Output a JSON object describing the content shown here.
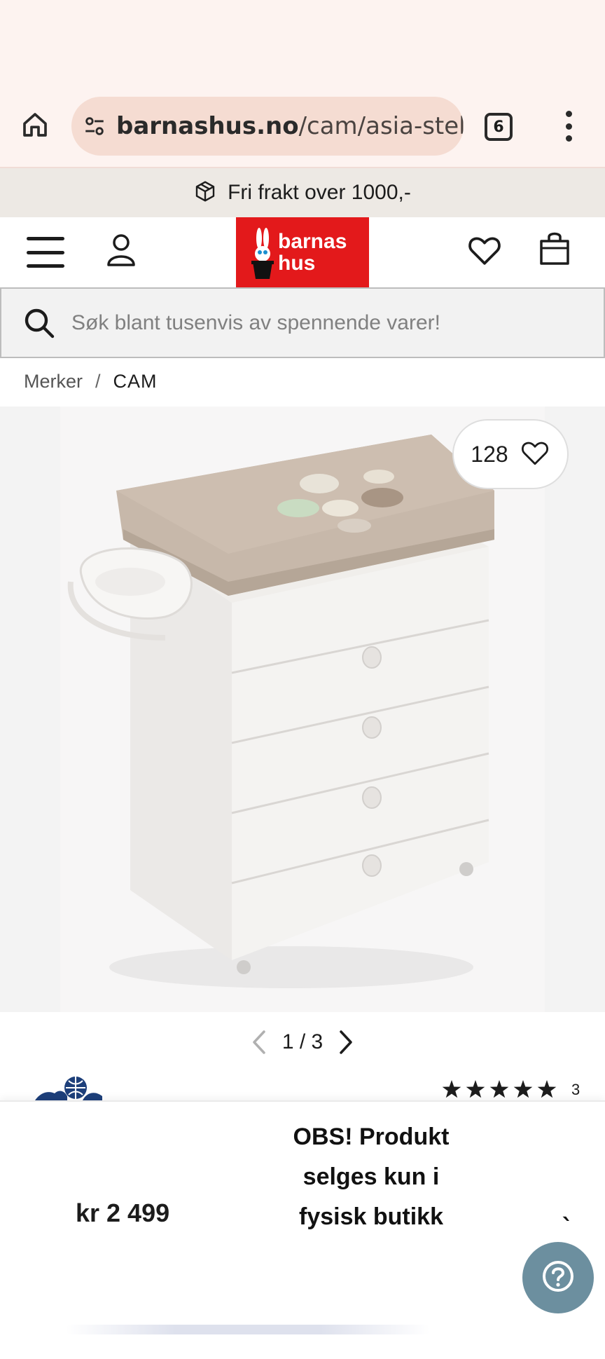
{
  "browser": {
    "url_domain": "barnashus.no",
    "url_path": "/cam/asia-stelle",
    "tab_count": "6",
    "icons": [
      "home-icon",
      "site-settings-icon",
      "tabs-icon",
      "more-vert-icon"
    ]
  },
  "banner": {
    "shipping_text": "Fri frakt over 1000,-",
    "icon": "box-icon"
  },
  "header": {
    "logo_line1": "barnas",
    "logo_line2": "hus",
    "brand_color": "#e3191b",
    "icons": [
      "menu-icon",
      "account-icon",
      "heart-icon",
      "bag-icon"
    ]
  },
  "search": {
    "placeholder": "Søk blant tusenvis av spennende varer!"
  },
  "breadcrumb": {
    "items": [
      {
        "label": "Merker"
      },
      {
        "label": "CAM"
      }
    ],
    "separator": "/"
  },
  "product": {
    "like_count": "128",
    "gallery_pager": "1 / 3",
    "rating_stars": 5,
    "rating_count": "3"
  },
  "sticky": {
    "price": "kr 2 499",
    "notice": "OBS! Produkt selges kun i fysisk butikk",
    "tick_mark": "`",
    "help_color": "#6c8f9f"
  }
}
